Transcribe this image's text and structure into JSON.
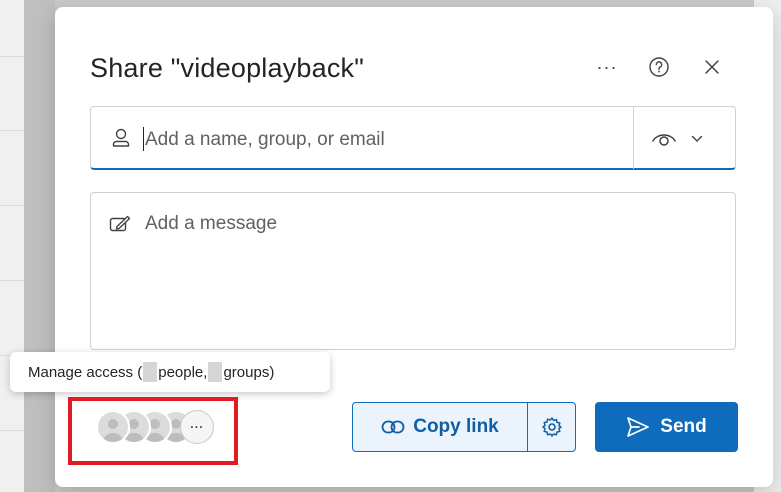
{
  "dialog": {
    "title": "Share \"videoplayback\"",
    "icons": {
      "more": "more-icon",
      "help": "help-icon",
      "close": "close-icon"
    }
  },
  "to_field": {
    "placeholder": "Add a name, group, or email",
    "value": "",
    "icons": {
      "person": "person-icon",
      "permission": "eye-icon",
      "dropdown": "chevron-down-icon"
    }
  },
  "message_field": {
    "placeholder": "Add a message",
    "value": "",
    "icon": "compose-icon"
  },
  "tooltip": {
    "prefix": "Manage access (",
    "people_word": "people,",
    "groups_word": "groups)"
  },
  "avatars": {
    "count_shown": 4,
    "more_label": "···"
  },
  "buttons": {
    "copy_link": "Copy link",
    "settings_icon": "gear-icon",
    "send": "Send",
    "send_icon": "send-icon"
  },
  "colors": {
    "accent": "#0f6cbd",
    "accent_light": "#ebf3fc",
    "highlight": "#e01b24",
    "text": "#242424"
  }
}
